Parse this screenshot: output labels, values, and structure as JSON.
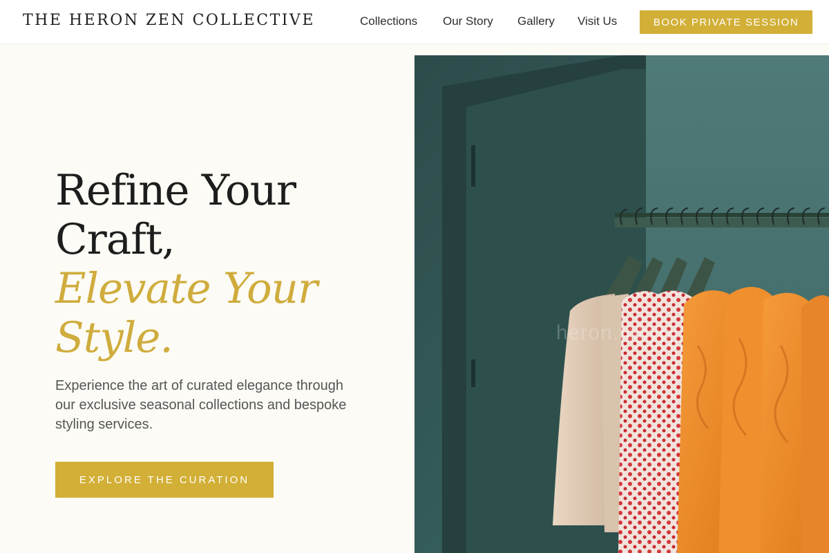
{
  "header": {
    "brand": "THE HERON ZEN COLLECTIVE",
    "nav": [
      "Collections",
      "Our Story",
      "Gallery",
      "Visit Us"
    ],
    "book_label": "BOOK PRIVATE SESSION"
  },
  "hero": {
    "headline_line1": "Refine Your",
    "headline_line2": "Craft,",
    "headline_accent_line1": "Elevate Your",
    "headline_accent_line2": "Style.",
    "lead": "Experience the art of curated elegance through our exclusive seasonal collections and bespoke styling services.",
    "cta_label": "EXPLORE THE CURATION"
  },
  "photo": {
    "watermark": "heron.tokyo",
    "subject": "clothing-rack-photo"
  },
  "colors": {
    "accent": "#d2af36",
    "background": "#fcfbf5",
    "text": "#1d1d1d"
  }
}
